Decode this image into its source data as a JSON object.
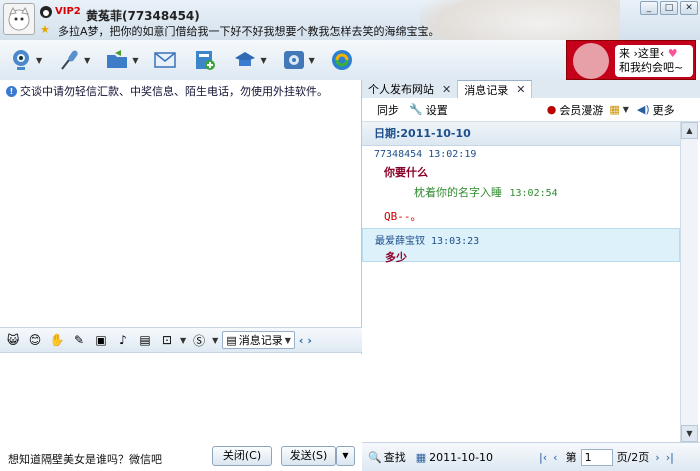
{
  "header": {
    "vip": "VIP2",
    "nickname": "黄菟菲(77348454)",
    "signature": "多拉A梦，把你的如意门借给我一下好不好我想要个教我怎样去笑的海绵宝宝。"
  },
  "window_buttons": [
    "_",
    "□",
    "✕"
  ],
  "ad": {
    "line1": "来 ›这里‹",
    "line2": "和我约会吧~",
    "heart": "♥"
  },
  "toolbar": {
    "icons": [
      "video-camera-icon",
      "microphone-icon",
      "folder-send-icon",
      "mail-icon",
      "add-contact-icon",
      "hat-icon",
      "settings-icon",
      "browser-icon"
    ]
  },
  "left": {
    "warning": "交谈中请勿轻信汇款、中奖信息、陌生电话，勿使用外挂软件。",
    "input_icons": [
      "emoticon-icon",
      "smiley-icon",
      "magic-icon",
      "font-icon",
      "screenshot-icon",
      "music-icon",
      "image-icon",
      "send-screen-icon",
      "quick-reply-icon"
    ],
    "message_record_button": "消息记录",
    "ad_text": "想知道隔壁美女是谁吗？微信吧",
    "close_button": "关闭(C)",
    "send_button": "发送(S)"
  },
  "tabs": [
    {
      "label": "个人发布网站",
      "close": "✕"
    },
    {
      "label": "消息记录",
      "close": "✕"
    }
  ],
  "right_toolbar": {
    "sync": "同步",
    "settings": "设置",
    "roaming": "会员漫游",
    "more": "更多"
  },
  "history": {
    "date": "日期:2011-10-10",
    "messages": [
      {
        "sender": "77348454",
        "time": "13:02:19",
        "text": "你要什么",
        "text_color": "#8a0026"
      },
      {
        "sender": "",
        "time": "13:02:54",
        "text": "枕着你的名字入睡",
        "text_color": "#2e8b2e"
      },
      {
        "sender": "",
        "time": "",
        "text": "QB--。",
        "text_color": "#d00000"
      },
      {
        "sender": "最爱薛宝钗",
        "time": "13:03:23",
        "text": "多少",
        "text_color": "#8a0026"
      }
    ]
  },
  "bottom_right": {
    "search": "查找",
    "date": "2011-10-10",
    "page_label": "第",
    "page_value": "1",
    "page_total": "页/2页"
  }
}
